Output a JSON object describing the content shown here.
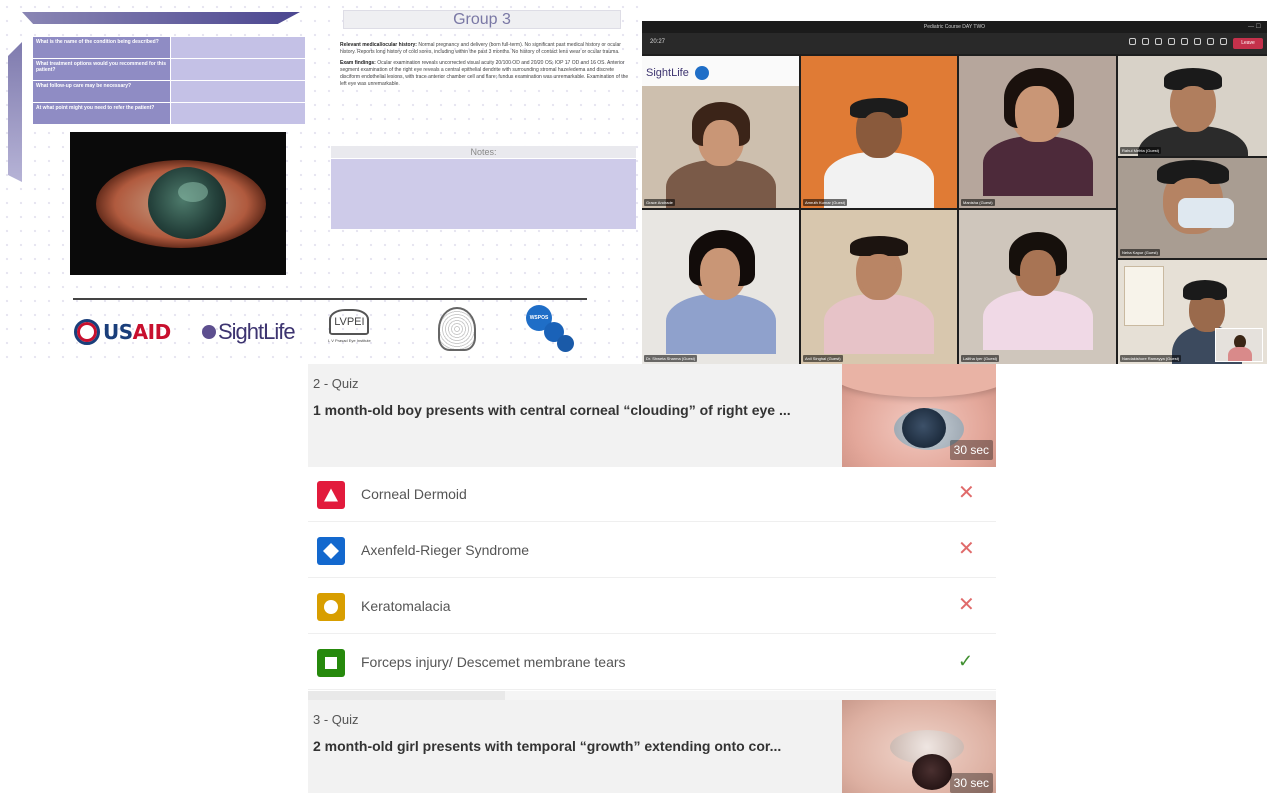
{
  "slide": {
    "group_title": "Group 3",
    "questions": [
      "What is the name of the condition being described?",
      "What treatment options would you recommend for this patient?",
      "What follow-up care may be necessary?",
      "At what point might you need to refer the patient?"
    ],
    "history_label": "Relevant medical/ocular history:",
    "history_text": "Normal pregnancy and delivery (born full-term). No significant past medical history or ocular history. Reports long history of cold sores, including within the past 3 months. No history of contact lens wear or ocular trauma.",
    "exam_label": "Exam findings:",
    "exam_text": "Ocular examination reveals uncorrected visual acuity 20/100 OD and 20/20 OS; IOP 17 OD and 16 OS. Anterior segment examination of the right eye reveals a central epithelial dendrite with surrounding stromal haze/edema and discrete disciform endothelial lesions, with trace anterior chamber cell and flare; fundus examination was unremarkable. Examination of the left eye was unremarkable.",
    "notes_label": "Notes:",
    "logos": {
      "usaid_a": "US",
      "usaid_b": "AID",
      "sightlife": "SightLife",
      "lvpei_mark": "LVPEI",
      "lvpei_caption": "L V Prasad Eye Institute",
      "wspos": "WSPOS"
    }
  },
  "teams": {
    "window_title": "Pediatric Course DAY TWO",
    "window_controls": "— ☐",
    "time": "20:27",
    "leave_label": "Leave",
    "sightlife_tile_logo": "SightLife",
    "participants": [
      {
        "name": "Grace Andrade"
      },
      {
        "name": "Amruth Kumar (Guest)"
      },
      {
        "name": "Manisha (Guest)"
      },
      {
        "name": "Rahul Mehta (Guest)"
      },
      {
        "name": "Neha Kapur (Guest)"
      },
      {
        "name": "Dr. Shweta Sharma (Guest)"
      },
      {
        "name": "Anil Singhal (Guest)"
      },
      {
        "name": "Lalitha Iyer (Guest)"
      },
      {
        "name": "Nandakishore Ramayya (Guest)"
      }
    ]
  },
  "quiz": {
    "q2": {
      "number": "2 - Quiz",
      "text": "1 month-old boy presents with central corneal “clouding” of right eye ...",
      "timer": "30 sec"
    },
    "answers": [
      {
        "label": "Corneal Dermoid",
        "shape": "triangle",
        "color": "#e21b3c",
        "correct": false
      },
      {
        "label": "Axenfeld-Rieger Syndrome",
        "shape": "diamond",
        "color": "#1368ce",
        "correct": false
      },
      {
        "label": "Keratomalacia",
        "shape": "circle",
        "color": "#d89e00",
        "correct": false
      },
      {
        "label": "Forceps injury/ Descemet membrane tears",
        "shape": "square",
        "color": "#26890c",
        "correct": true
      }
    ],
    "wrong_mark": "✕",
    "right_mark": "✓",
    "q3": {
      "number": "3 - Quiz",
      "text": "2 month-old girl presents with temporal “growth” extending onto cor...",
      "timer": "30 sec"
    }
  }
}
